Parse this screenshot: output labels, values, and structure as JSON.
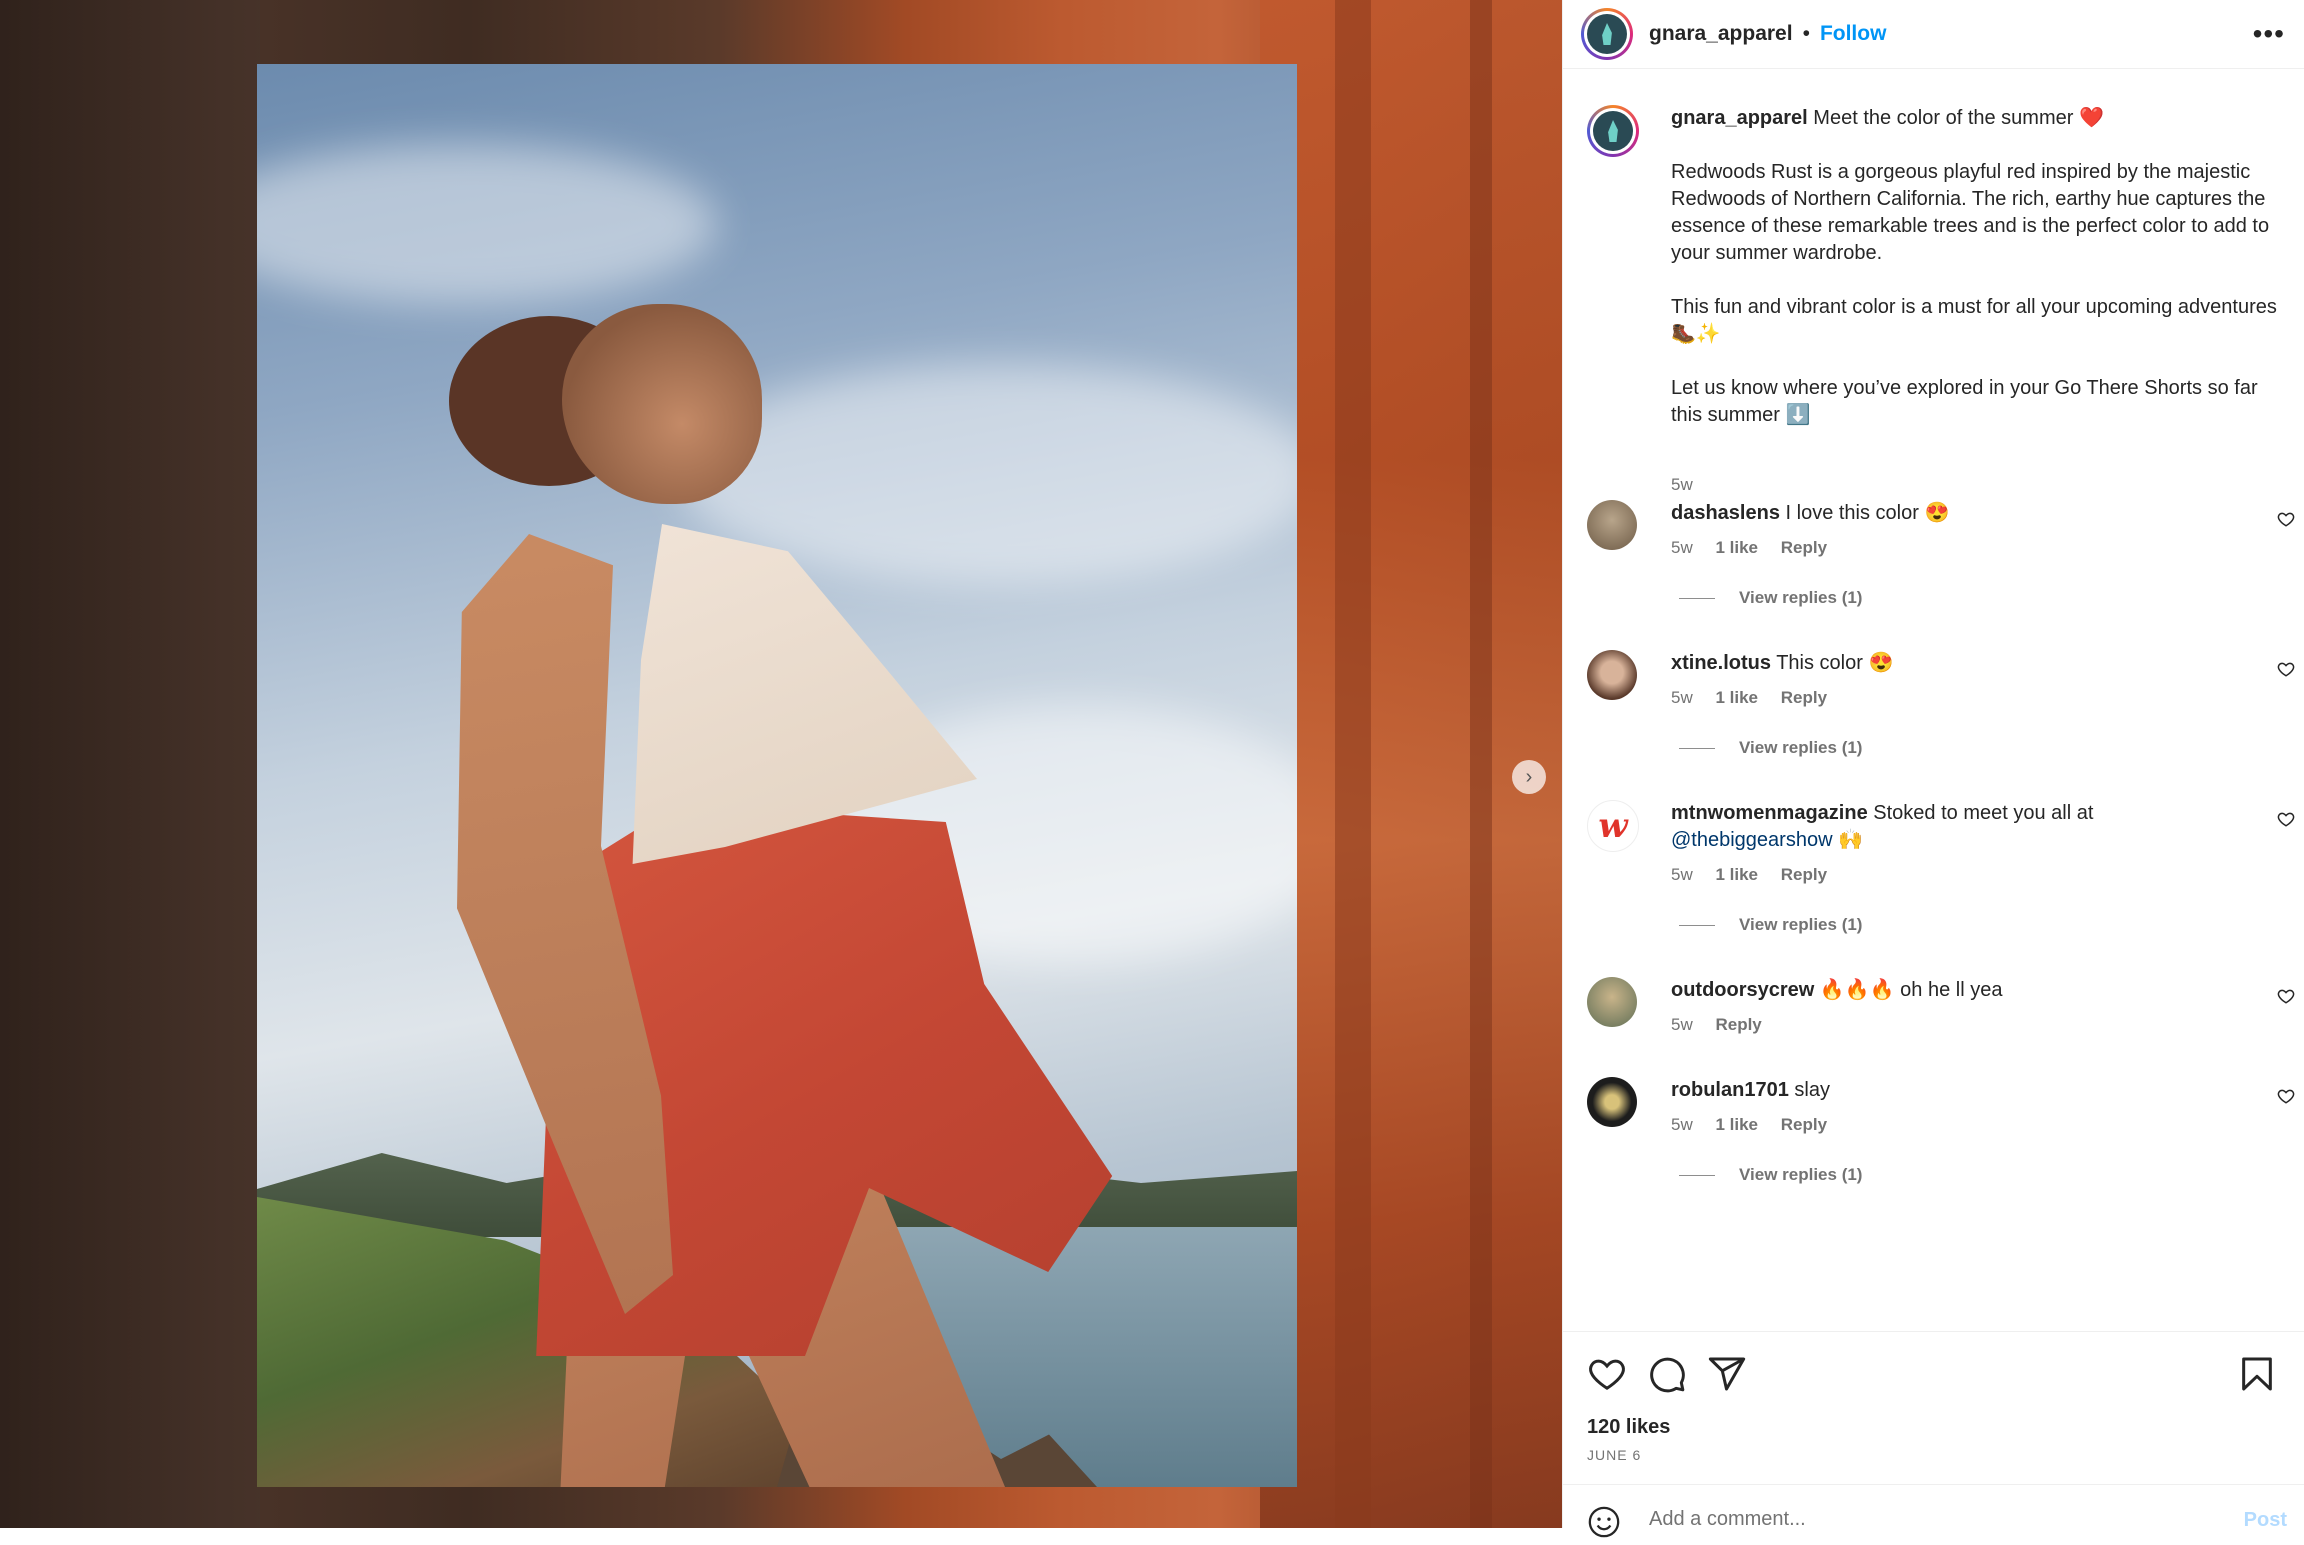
{
  "header": {
    "username": "gnara_apparel",
    "separator": "•",
    "follow_label": "Follow",
    "more_label": "•••"
  },
  "caption": {
    "username": "gnara_apparel",
    "line1": "Meet the color of the summer ❤️",
    "para1": "Redwoods Rust is a gorgeous playful red inspired by the majestic Redwoods of Northern California. The rich, earthy hue captures the essence of these remarkable trees and is the perfect color to add to your summer wardrobe.",
    "para2": "This fun and vibrant color is a must for all your upcoming adventures 🥾✨",
    "para3": "Let us know where you’ve explored in your Go There Shorts so far this summer ⬇️",
    "time": "5w"
  },
  "comments": [
    {
      "username": "dashaslens",
      "text": "I love this color 😍",
      "time": "5w",
      "likes": "1 like",
      "reply_label": "Reply",
      "view_replies": "View replies (1)",
      "avatar_color": "#8a7a66"
    },
    {
      "username": "xtine.lotus",
      "text": "This color 😍",
      "time": "5w",
      "likes": "1 like",
      "reply_label": "Reply",
      "view_replies": "View replies (1)",
      "avatar_color": "#6e4a3a"
    },
    {
      "username": "mtnwomenmagazine",
      "text": "Stoked to meet you all at",
      "mention": "@thebiggearshow",
      "text_after": "🙌",
      "time": "5w",
      "likes": "1 like",
      "reply_label": "Reply",
      "view_replies": "View replies (1)",
      "avatar_color": "#e0342b"
    },
    {
      "username": "outdoorsycrew",
      "text": "🔥🔥🔥 oh he ll yea",
      "time": "5w",
      "reply_label": "Reply",
      "avatar_color": "#7b8c6a"
    },
    {
      "username": "robulan1701",
      "text": "slay",
      "time": "5w",
      "likes": "1 like",
      "reply_label": "Reply",
      "view_replies": "View replies (1)",
      "avatar_color": "#1d1d1d"
    }
  ],
  "actions": {
    "like_icon": "heart-icon",
    "comment_icon": "comment-icon",
    "share_icon": "share-icon",
    "save_icon": "bookmark-icon",
    "likes": "120 likes",
    "date": "JUNE 6"
  },
  "add_comment": {
    "placeholder": "Add a comment...",
    "post_label": "Post"
  },
  "colors": {
    "accent": "#0095f6",
    "mention": "#00376b",
    "muted": "#737373"
  }
}
